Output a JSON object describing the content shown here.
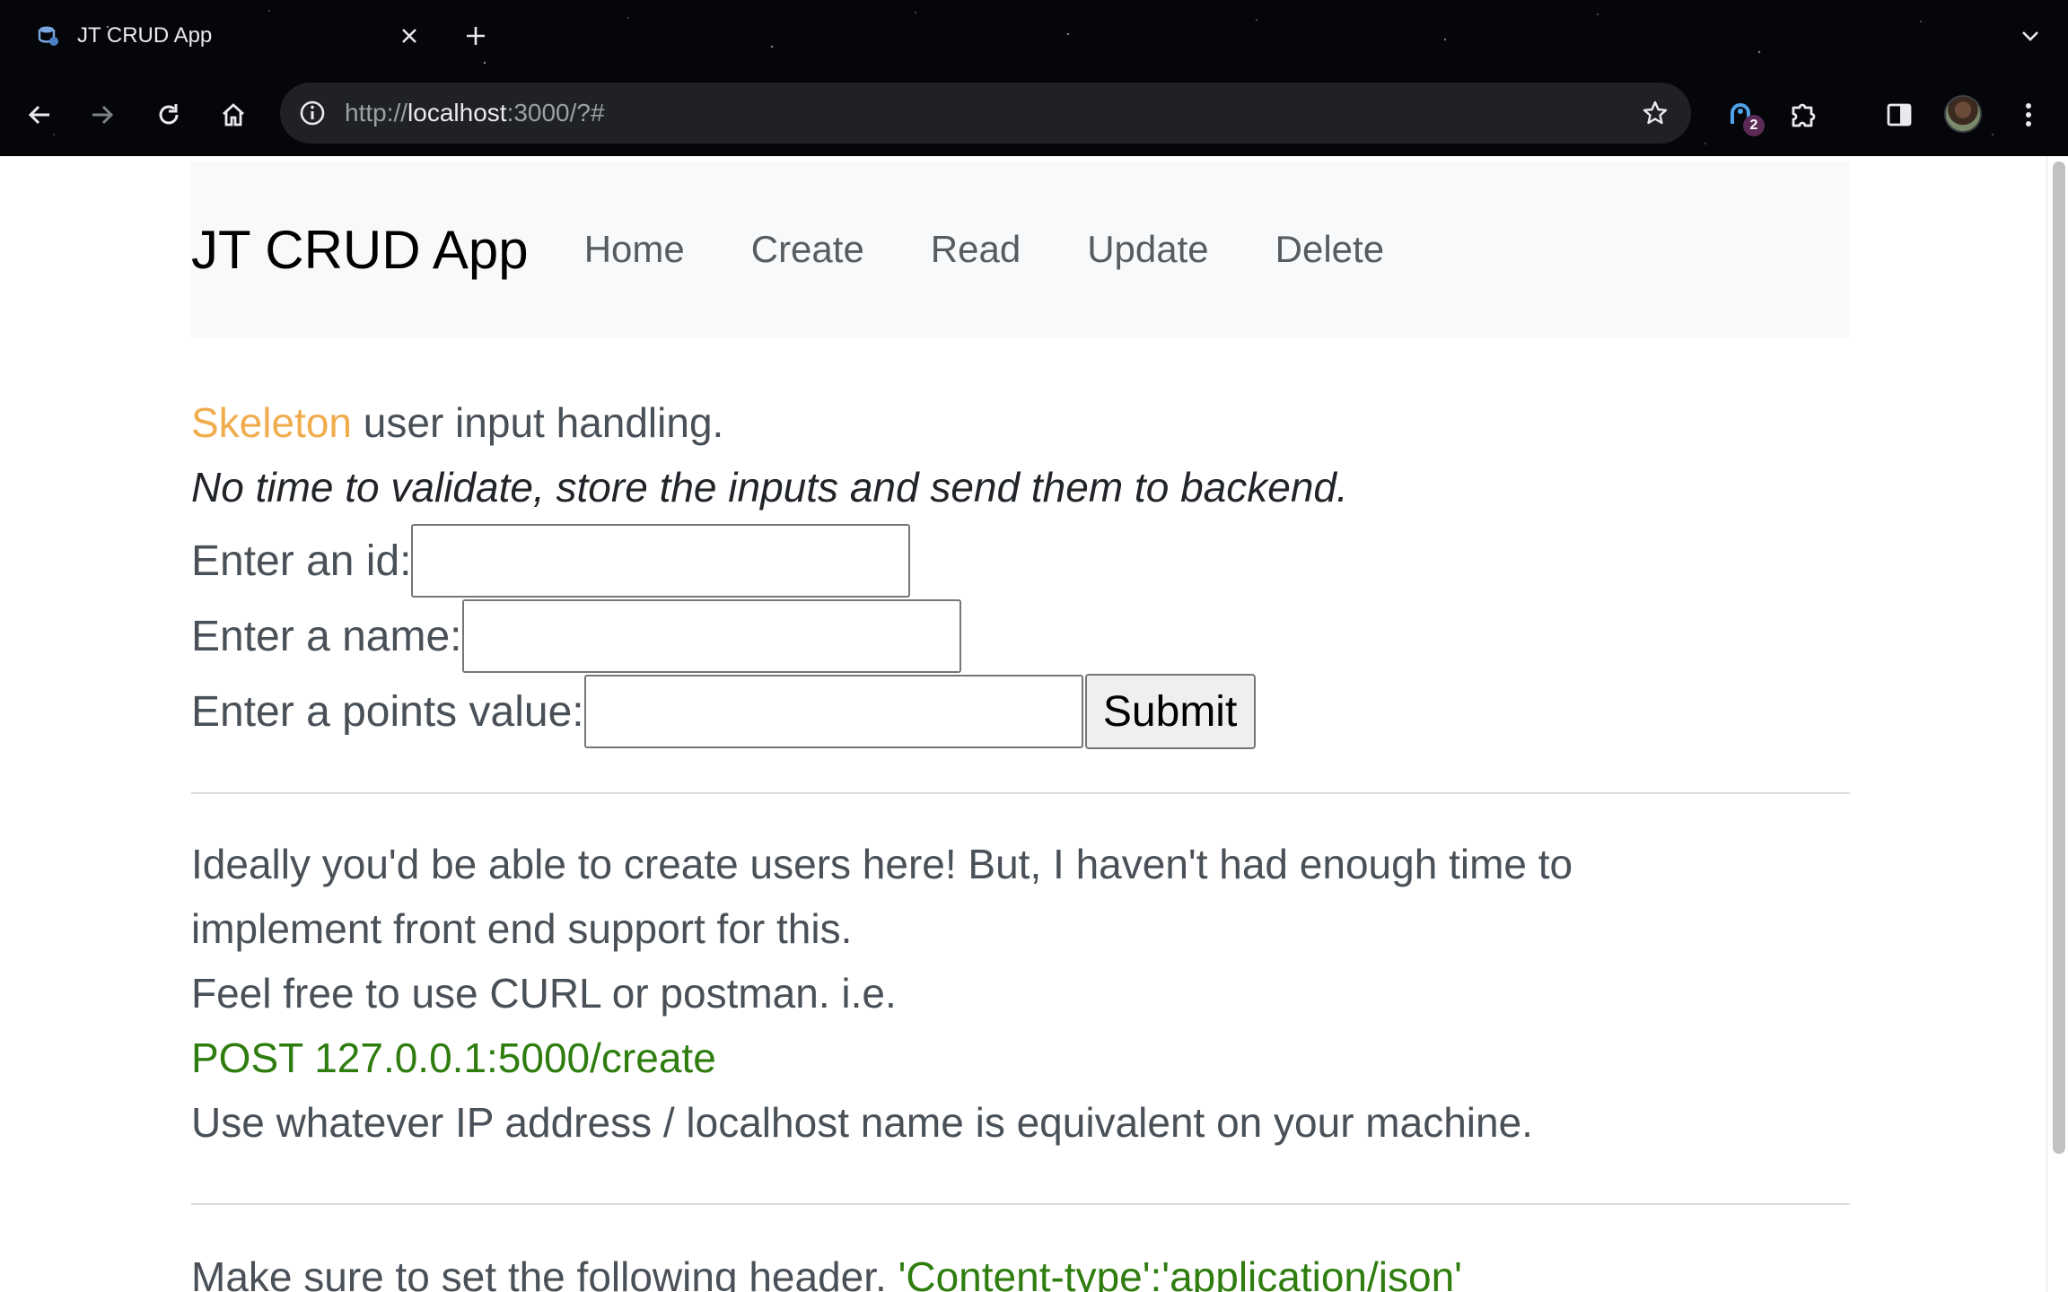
{
  "browser": {
    "tab_title": "JT CRUD App",
    "new_tab_label": "+",
    "url_scheme": "http://",
    "url_host": "localhost",
    "url_rest": ":3000/?#",
    "extension_badge": "2"
  },
  "navbar": {
    "brand": "JT CRUD App",
    "links": [
      "Home",
      "Create",
      "Read",
      "Update",
      "Delete"
    ]
  },
  "intro": {
    "accent_word": "Skeleton",
    "rest": " user input handling.",
    "note": "No time to validate, store the inputs and send them to backend."
  },
  "form": {
    "id_label": "Enter an id:",
    "id_value": "",
    "name_label": "Enter a name:",
    "name_value": "",
    "points_label": "Enter a points value:",
    "points_value": "",
    "submit_label": "Submit"
  },
  "info": {
    "line1": "Ideally you'd be able to create users here! But, I haven't had enough time to",
    "line2": "implement front end support for this.",
    "line3": "Feel free to use CURL or postman. i.e.",
    "endpoint": "POST 127.0.0.1:5000/create",
    "line4": "Use whatever IP address / localhost name is equivalent on your machine.",
    "header_prefix": "Make sure to set the following header. ",
    "header_value": "'Content-type':'application/json'"
  },
  "colors": {
    "accent": "#f0ad4e",
    "code_green": "#2f7d0f",
    "navbar_bg": "#f8f9fa"
  }
}
